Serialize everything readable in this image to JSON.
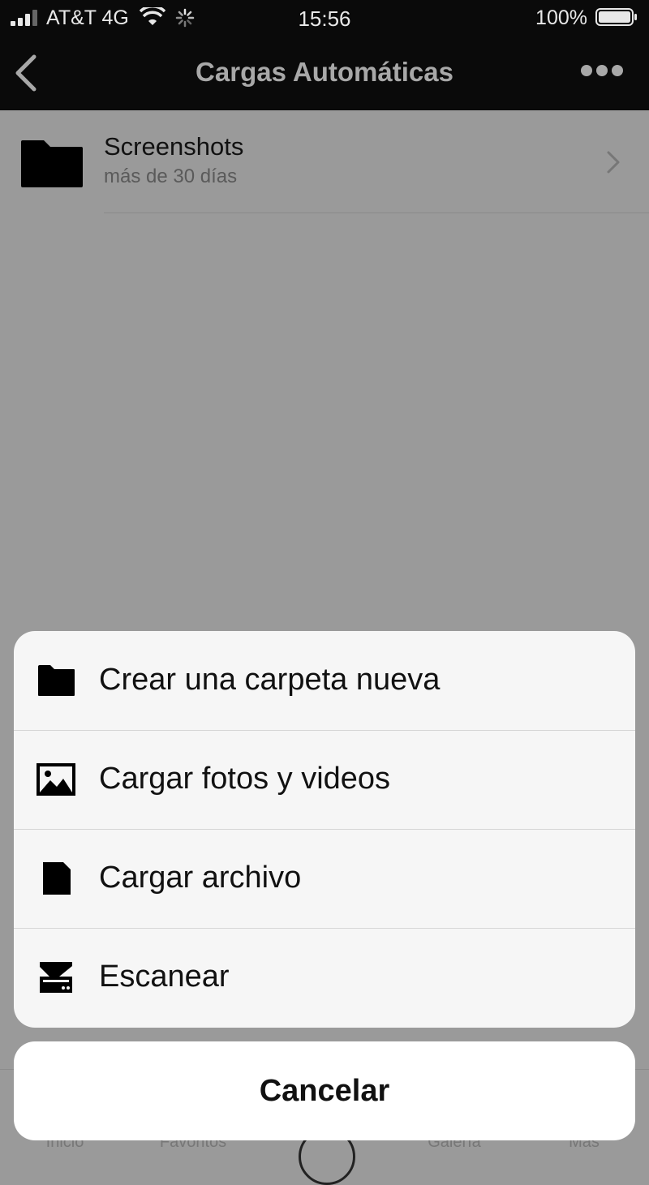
{
  "status_bar": {
    "carrier": "AT&T 4G",
    "time": "15:56",
    "battery": "100%"
  },
  "nav": {
    "title": "Cargas Automáticas"
  },
  "folder_row": {
    "name": "Screenshots",
    "subtitle": "más de 30 días"
  },
  "tab_bar": {
    "items": [
      "Inicio",
      "Favoritos",
      "Galería",
      "Más"
    ]
  },
  "action_sheet": {
    "actions": [
      {
        "label": "Crear una carpeta nueva",
        "icon": "folder-icon"
      },
      {
        "label": "Cargar fotos y videos",
        "icon": "image-icon"
      },
      {
        "label": "Cargar archivo",
        "icon": "file-icon"
      },
      {
        "label": "Escanear",
        "icon": "scanner-icon"
      }
    ],
    "cancel_label": "Cancelar"
  },
  "colors": {
    "overlay": "#9a9a9a",
    "topbar": "#0a0a0a",
    "sheet": "#f6f6f6"
  }
}
